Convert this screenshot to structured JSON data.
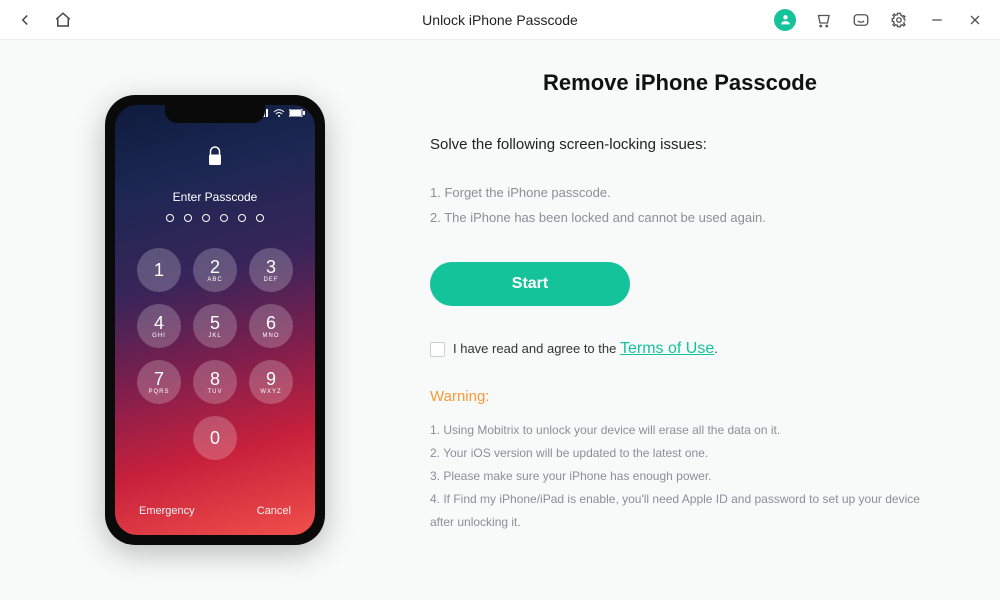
{
  "titlebar": {
    "title": "Unlock iPhone Passcode"
  },
  "phone": {
    "enter_passcode": "Enter Passcode",
    "emergency": "Emergency",
    "cancel": "Cancel",
    "keys": [
      {
        "n": "1",
        "l": ""
      },
      {
        "n": "2",
        "l": "ABC"
      },
      {
        "n": "3",
        "l": "DEF"
      },
      {
        "n": "4",
        "l": "GHI"
      },
      {
        "n": "5",
        "l": "JKL"
      },
      {
        "n": "6",
        "l": "MNO"
      },
      {
        "n": "7",
        "l": "PQRS"
      },
      {
        "n": "8",
        "l": "TUV"
      },
      {
        "n": "9",
        "l": "WXYZ"
      },
      {
        "n": "0",
        "l": ""
      }
    ]
  },
  "main": {
    "heading": "Remove iPhone Passcode",
    "subhead": "Solve the following screen-locking issues:",
    "issues": [
      "1. Forget the iPhone passcode.",
      "2. The iPhone has been locked and cannot be used again."
    ],
    "start": "Start",
    "agree_prefix": "I have read and agree to the ",
    "terms": "Terms of Use",
    "agree_suffix": ".",
    "warning_label": "Warning:",
    "warnings": [
      "1. Using Mobitrix to unlock your device will erase all the data on it.",
      "2. Your iOS version will be updated to the latest one.",
      "3. Please make sure your iPhone has enough power.",
      "4. If Find my iPhone/iPad is enable, you'll need Apple ID and password to set up your device after unlocking it."
    ]
  }
}
